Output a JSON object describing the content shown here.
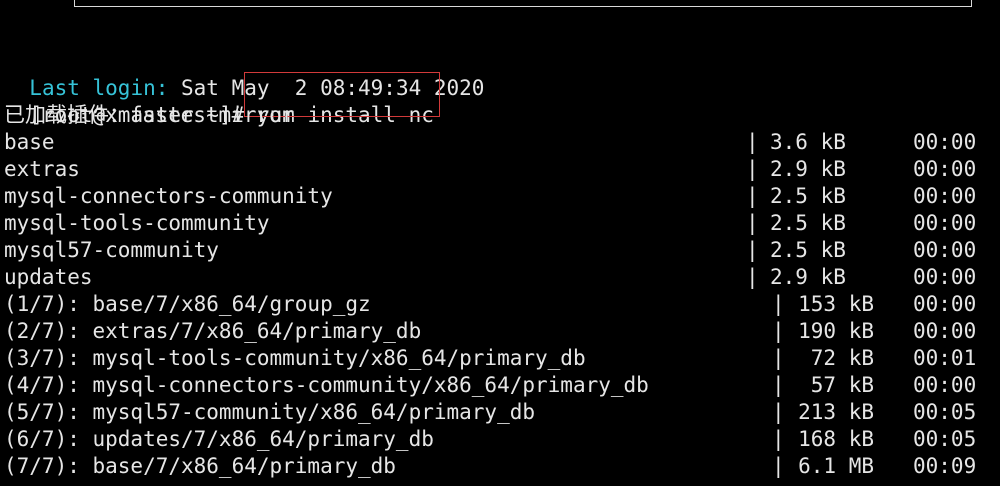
{
  "terminal": {
    "last_login_label": "Last login:",
    "last_login_value": " Sat May  2 08:49:34 2020",
    "prompt": "[root@xmaster ~]# ",
    "command": "yum install nc",
    "plugin_line": "已加载插件：fastestmirror",
    "repos": [
      {
        "name": "base",
        "sep": "|",
        "size": "3.6 kB",
        "time": "00:00"
      },
      {
        "name": "extras",
        "sep": "|",
        "size": "2.9 kB",
        "time": "00:00"
      },
      {
        "name": "mysql-connectors-community",
        "sep": "|",
        "size": "2.5 kB",
        "time": "00:00"
      },
      {
        "name": "mysql-tools-community",
        "sep": "|",
        "size": "2.5 kB",
        "time": "00:00"
      },
      {
        "name": "mysql57-community",
        "sep": "|",
        "size": "2.5 kB",
        "time": "00:00"
      },
      {
        "name": "updates",
        "sep": "|",
        "size": "2.9 kB",
        "time": "00:00"
      }
    ],
    "downloads": [
      {
        "name": "(1/7): base/7/x86_64/group_gz",
        "sep": "|",
        "size": "153 kB",
        "time": "00:00"
      },
      {
        "name": "(2/7): extras/7/x86_64/primary_db",
        "sep": "|",
        "size": "190 kB",
        "time": "00:00"
      },
      {
        "name": "(3/7): mysql-tools-community/x86_64/primary_db",
        "sep": "|",
        "size": "72 kB",
        "time": "00:01"
      },
      {
        "name": "(4/7): mysql-connectors-community/x86_64/primary_db",
        "sep": "|",
        "size": "57 kB",
        "time": "00:00"
      },
      {
        "name": "(5/7): mysql57-community/x86_64/primary_db",
        "sep": "|",
        "size": "213 kB",
        "time": "00:05"
      },
      {
        "name": "(6/7): updates/7/x86_64/primary_db",
        "sep": "|",
        "size": "168 kB",
        "time": "00:05"
      },
      {
        "name": "(7/7): base/7/x86_64/primary_db",
        "sep": "|",
        "size": "6.1 MB",
        "time": "00:09"
      }
    ]
  },
  "colors": {
    "background": "#000000",
    "text": "#e6e6e6",
    "login_label": "#36c3d8",
    "highlight_box": "#d23a3a"
  }
}
